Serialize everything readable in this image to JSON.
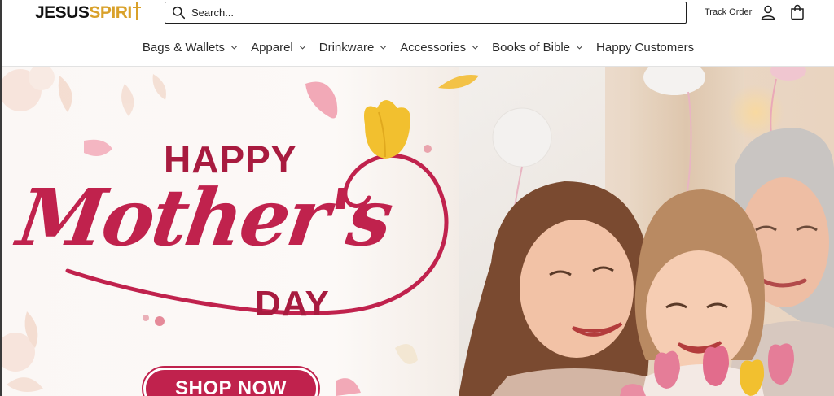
{
  "header": {
    "logo": {
      "part1": "JESUS",
      "part2": "SPIRI"
    },
    "search": {
      "placeholder": "Search..."
    },
    "track_order": "Track Order"
  },
  "nav": {
    "items": [
      {
        "label": "Bags & Wallets",
        "has_dropdown": true
      },
      {
        "label": "Apparel",
        "has_dropdown": true
      },
      {
        "label": "Drinkware",
        "has_dropdown": true
      },
      {
        "label": "Accessories",
        "has_dropdown": true
      },
      {
        "label": "Books of Bible",
        "has_dropdown": true
      },
      {
        "label": "Happy Customers",
        "has_dropdown": false
      }
    ]
  },
  "hero": {
    "line1": "HAPPY",
    "line2": "Mother's",
    "line3": "DAY",
    "cta": "SHOP NOW"
  },
  "icons": [
    "search-icon",
    "account-icon",
    "cart-icon",
    "chevron-down-icon"
  ],
  "colors": {
    "accent": "#c0224d",
    "accent_dark": "#a81b3f",
    "logo_gold": "#d9a12a"
  }
}
